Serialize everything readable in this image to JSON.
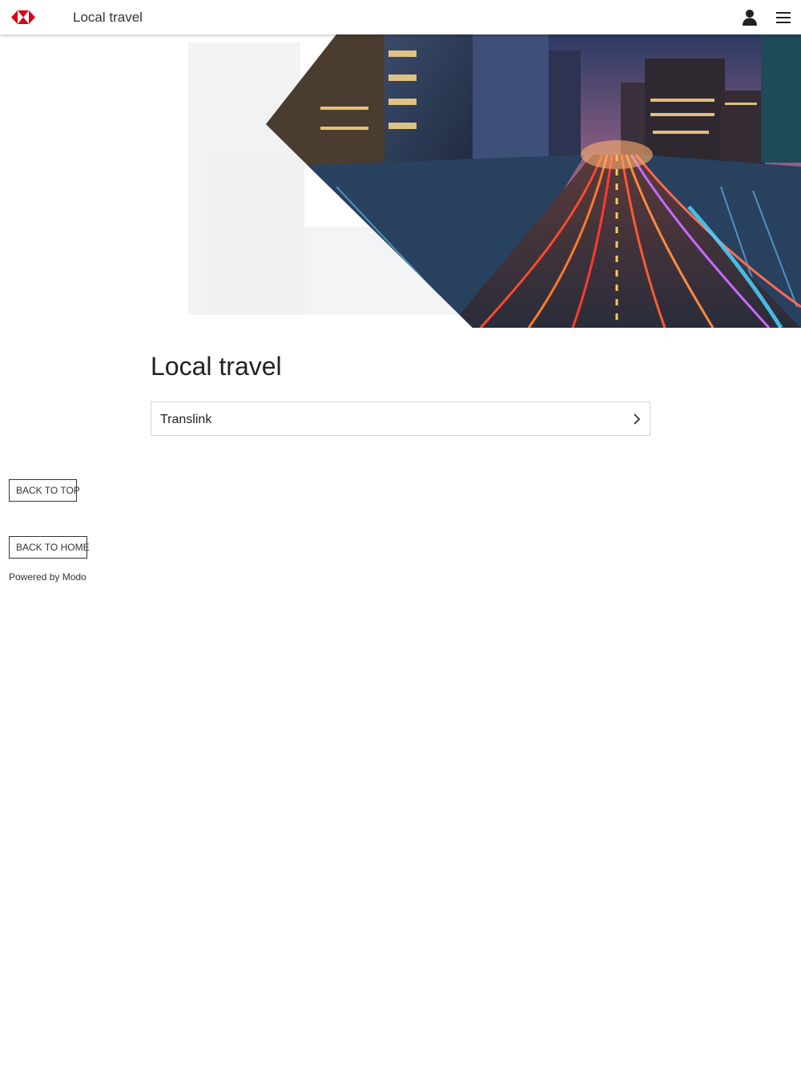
{
  "header": {
    "title": "Local travel",
    "logo_icon": "hsbc-hexagon-logo-icon",
    "user_icon": "user-icon",
    "menu_icon": "hamburger-menu-icon"
  },
  "hero": {
    "image": "city-highway-light-trails-photo"
  },
  "main": {
    "title": "Local travel",
    "items": [
      {
        "label": "Translink",
        "icon": "chevron-right-icon"
      }
    ]
  },
  "footer": {
    "back_to_top": "Back to top",
    "back_to_home": "Back to home",
    "powered_by": "Powered by Modo"
  },
  "colors": {
    "brand_red": "#db0011",
    "text": "#222222",
    "border": "#d7d8d6"
  }
}
